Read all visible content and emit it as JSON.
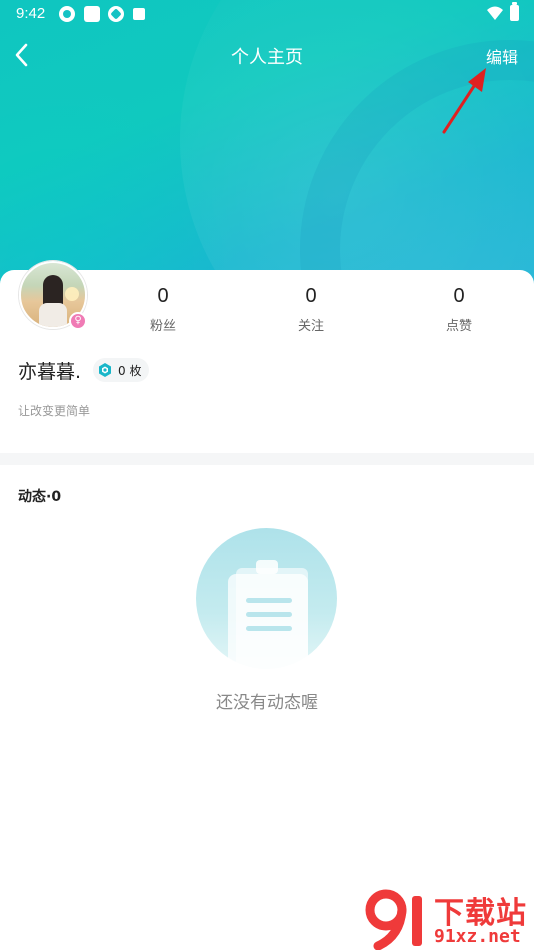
{
  "status_bar": {
    "time": "9:42",
    "icons": [
      "app-notification-icon",
      "app-square-icon",
      "app-notification-icon",
      "app-a-icon",
      "wifi-icon",
      "battery-icon"
    ]
  },
  "nav": {
    "title": "个人主页",
    "edit_label": "编辑",
    "back_icon": "back-arrow-icon"
  },
  "profile": {
    "username": "亦暮暮.",
    "coin_count": "0 枚",
    "bio": "让改变更简单",
    "gender": "female",
    "stats": [
      {
        "value": "0",
        "label": "粉丝"
      },
      {
        "value": "0",
        "label": "关注"
      },
      {
        "value": "0",
        "label": "点赞"
      }
    ]
  },
  "feed": {
    "title": "动态·0",
    "empty_text": "还没有动态喔"
  },
  "watermark": {
    "cn": "下载站",
    "url": "91xz.net"
  },
  "colors": {
    "header_teal": "#10c9bf",
    "header_blue": "#28b7d8",
    "gender_pink": "#f07bb5",
    "annotation_red": "#e02020",
    "watermark_red": "#ef3a3a"
  }
}
